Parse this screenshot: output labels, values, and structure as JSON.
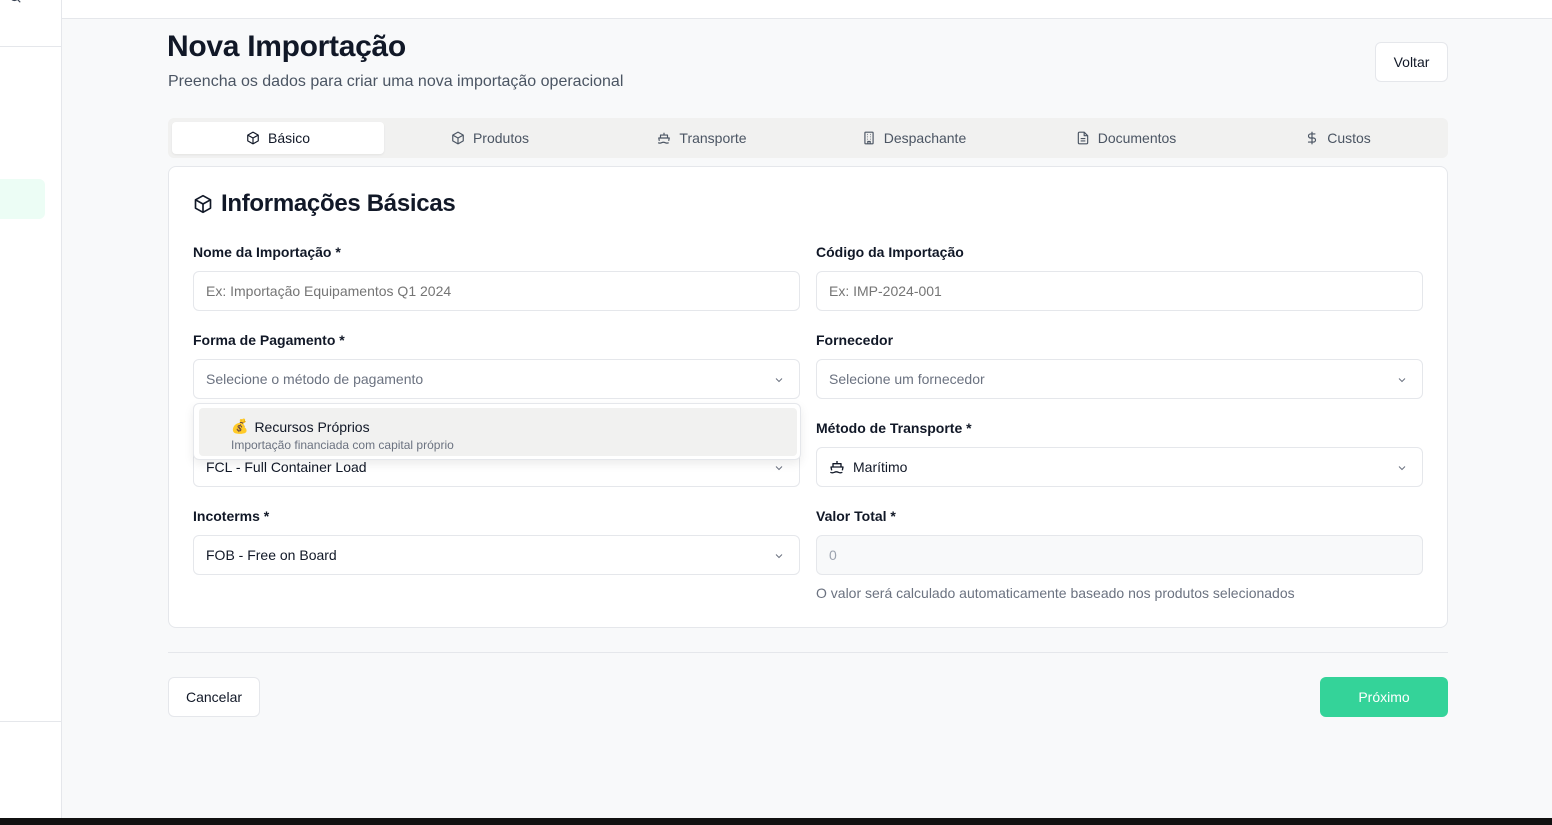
{
  "header": {
    "title": "Nova Importação",
    "subtitle": "Preencha os dados para criar uma nova importação operacional",
    "back_label": "Voltar"
  },
  "tabs": [
    {
      "label": "Básico",
      "icon": "package-icon",
      "active": true
    },
    {
      "label": "Produtos",
      "icon": "package-icon",
      "active": false
    },
    {
      "label": "Transporte",
      "icon": "ship-icon",
      "active": false
    },
    {
      "label": "Despachante",
      "icon": "building-icon",
      "active": false
    },
    {
      "label": "Documentos",
      "icon": "file-icon",
      "active": false
    },
    {
      "label": "Custos",
      "icon": "dollar-icon",
      "active": false
    }
  ],
  "card": {
    "title": "Informações Básicas",
    "fields": {
      "nome": {
        "label": "Nome da Importação *",
        "placeholder": "Ex: Importação Equipamentos Q1 2024",
        "value": ""
      },
      "codigo": {
        "label": "Código da Importação",
        "placeholder": "Ex: IMP-2024-001",
        "value": ""
      },
      "pagamento": {
        "label": "Forma de Pagamento *",
        "placeholder": "Selecione o método de pagamento"
      },
      "fornecedor": {
        "label": "Fornecedor",
        "placeholder": "Selecione um fornecedor"
      },
      "carga": {
        "value": "FCL - Full Container Load"
      },
      "transporte": {
        "label": "Método de Transporte *",
        "value": "Marítimo"
      },
      "incoterms": {
        "label": "Incoterms *",
        "value": "FOB - Free on Board"
      },
      "valor": {
        "label": "Valor Total *",
        "value": "0",
        "hint": "O valor será calculado automaticamente baseado nos produtos selecionados"
      }
    },
    "payment_dropdown": {
      "options": [
        {
          "emoji": "💰",
          "title": "Recursos Próprios",
          "description": "Importação financiada com capital próprio"
        }
      ]
    }
  },
  "footer": {
    "cancel_label": "Cancelar",
    "next_label": "Próximo"
  },
  "colors": {
    "primary": "#34d399",
    "border": "#e5e7eb",
    "tab_bg": "#f1f1f0",
    "active_nav_bg": "#ecfdf5"
  }
}
